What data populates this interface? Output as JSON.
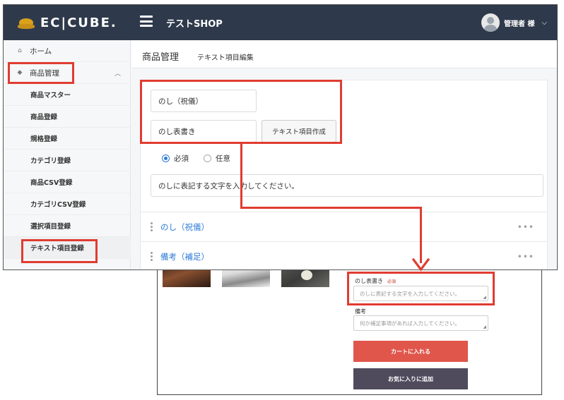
{
  "admin": {
    "logo_text": "EC|CUBE.",
    "shop_name": "テストSHOP",
    "user_label": "管理者 様",
    "sidebar": {
      "home": "ホーム",
      "products": "商品管理",
      "items": [
        "商品マスター",
        "商品登録",
        "規格登録",
        "カテゴリ登録",
        "商品CSV登録",
        "カテゴリCSV登録",
        "選択項目登録",
        "テキスト項目登録"
      ]
    },
    "page_title": "商品管理",
    "page_subtitle": "テキスト項目編集",
    "form": {
      "name_input": "のし（祝儀）",
      "label_input": "のし表書き",
      "create_button": "テキスト項目作成",
      "radio_required": "必須",
      "radio_optional": "任意",
      "placeholder_input": "のしに表記する文字を入力してください。"
    },
    "list": [
      "のし（祝儀）",
      "備考（補足）"
    ]
  },
  "storefront": {
    "noshi_label": "のし表書き",
    "required_badge": "必須",
    "noshi_placeholder": "のしに表記する文字を入力してください。",
    "notes_label": "備考",
    "notes_placeholder": "何か補足事項があれば入力してください。",
    "add_to_cart": "カートに入れる",
    "add_to_favorites": "お気に入りに追加"
  },
  "colors": {
    "topbar": "#2e3a4b",
    "link": "#2e7bd6",
    "annotation": "#e03c31",
    "cart_button": "#e0564b",
    "favorite_button": "#4f4a5c"
  }
}
